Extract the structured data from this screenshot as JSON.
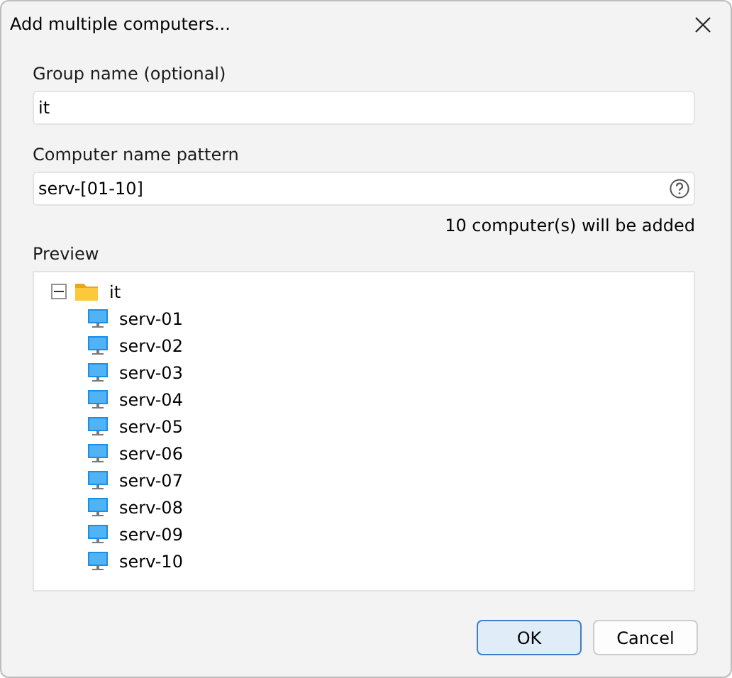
{
  "window": {
    "title": "Add multiple computers..."
  },
  "group_name": {
    "label": "Group name (optional)",
    "value": "it"
  },
  "pattern": {
    "label": "Computer name pattern",
    "value": "serv-[01-10]"
  },
  "count_text": "10 computer(s) will be added",
  "preview": {
    "label": "Preview",
    "tree": [
      {
        "label": "it",
        "kind": "group",
        "expanded": true,
        "children": [
          {
            "label": "serv-01",
            "kind": "computer"
          },
          {
            "label": "serv-02",
            "kind": "computer"
          },
          {
            "label": "serv-03",
            "kind": "computer"
          },
          {
            "label": "serv-04",
            "kind": "computer"
          },
          {
            "label": "serv-05",
            "kind": "computer"
          },
          {
            "label": "serv-06",
            "kind": "computer"
          },
          {
            "label": "serv-07",
            "kind": "computer"
          },
          {
            "label": "serv-08",
            "kind": "computer"
          },
          {
            "label": "serv-09",
            "kind": "computer"
          },
          {
            "label": "serv-10",
            "kind": "computer"
          }
        ]
      }
    ]
  },
  "buttons": [
    {
      "label": "OK",
      "default": true
    },
    {
      "label": "Cancel",
      "default": false
    }
  ]
}
